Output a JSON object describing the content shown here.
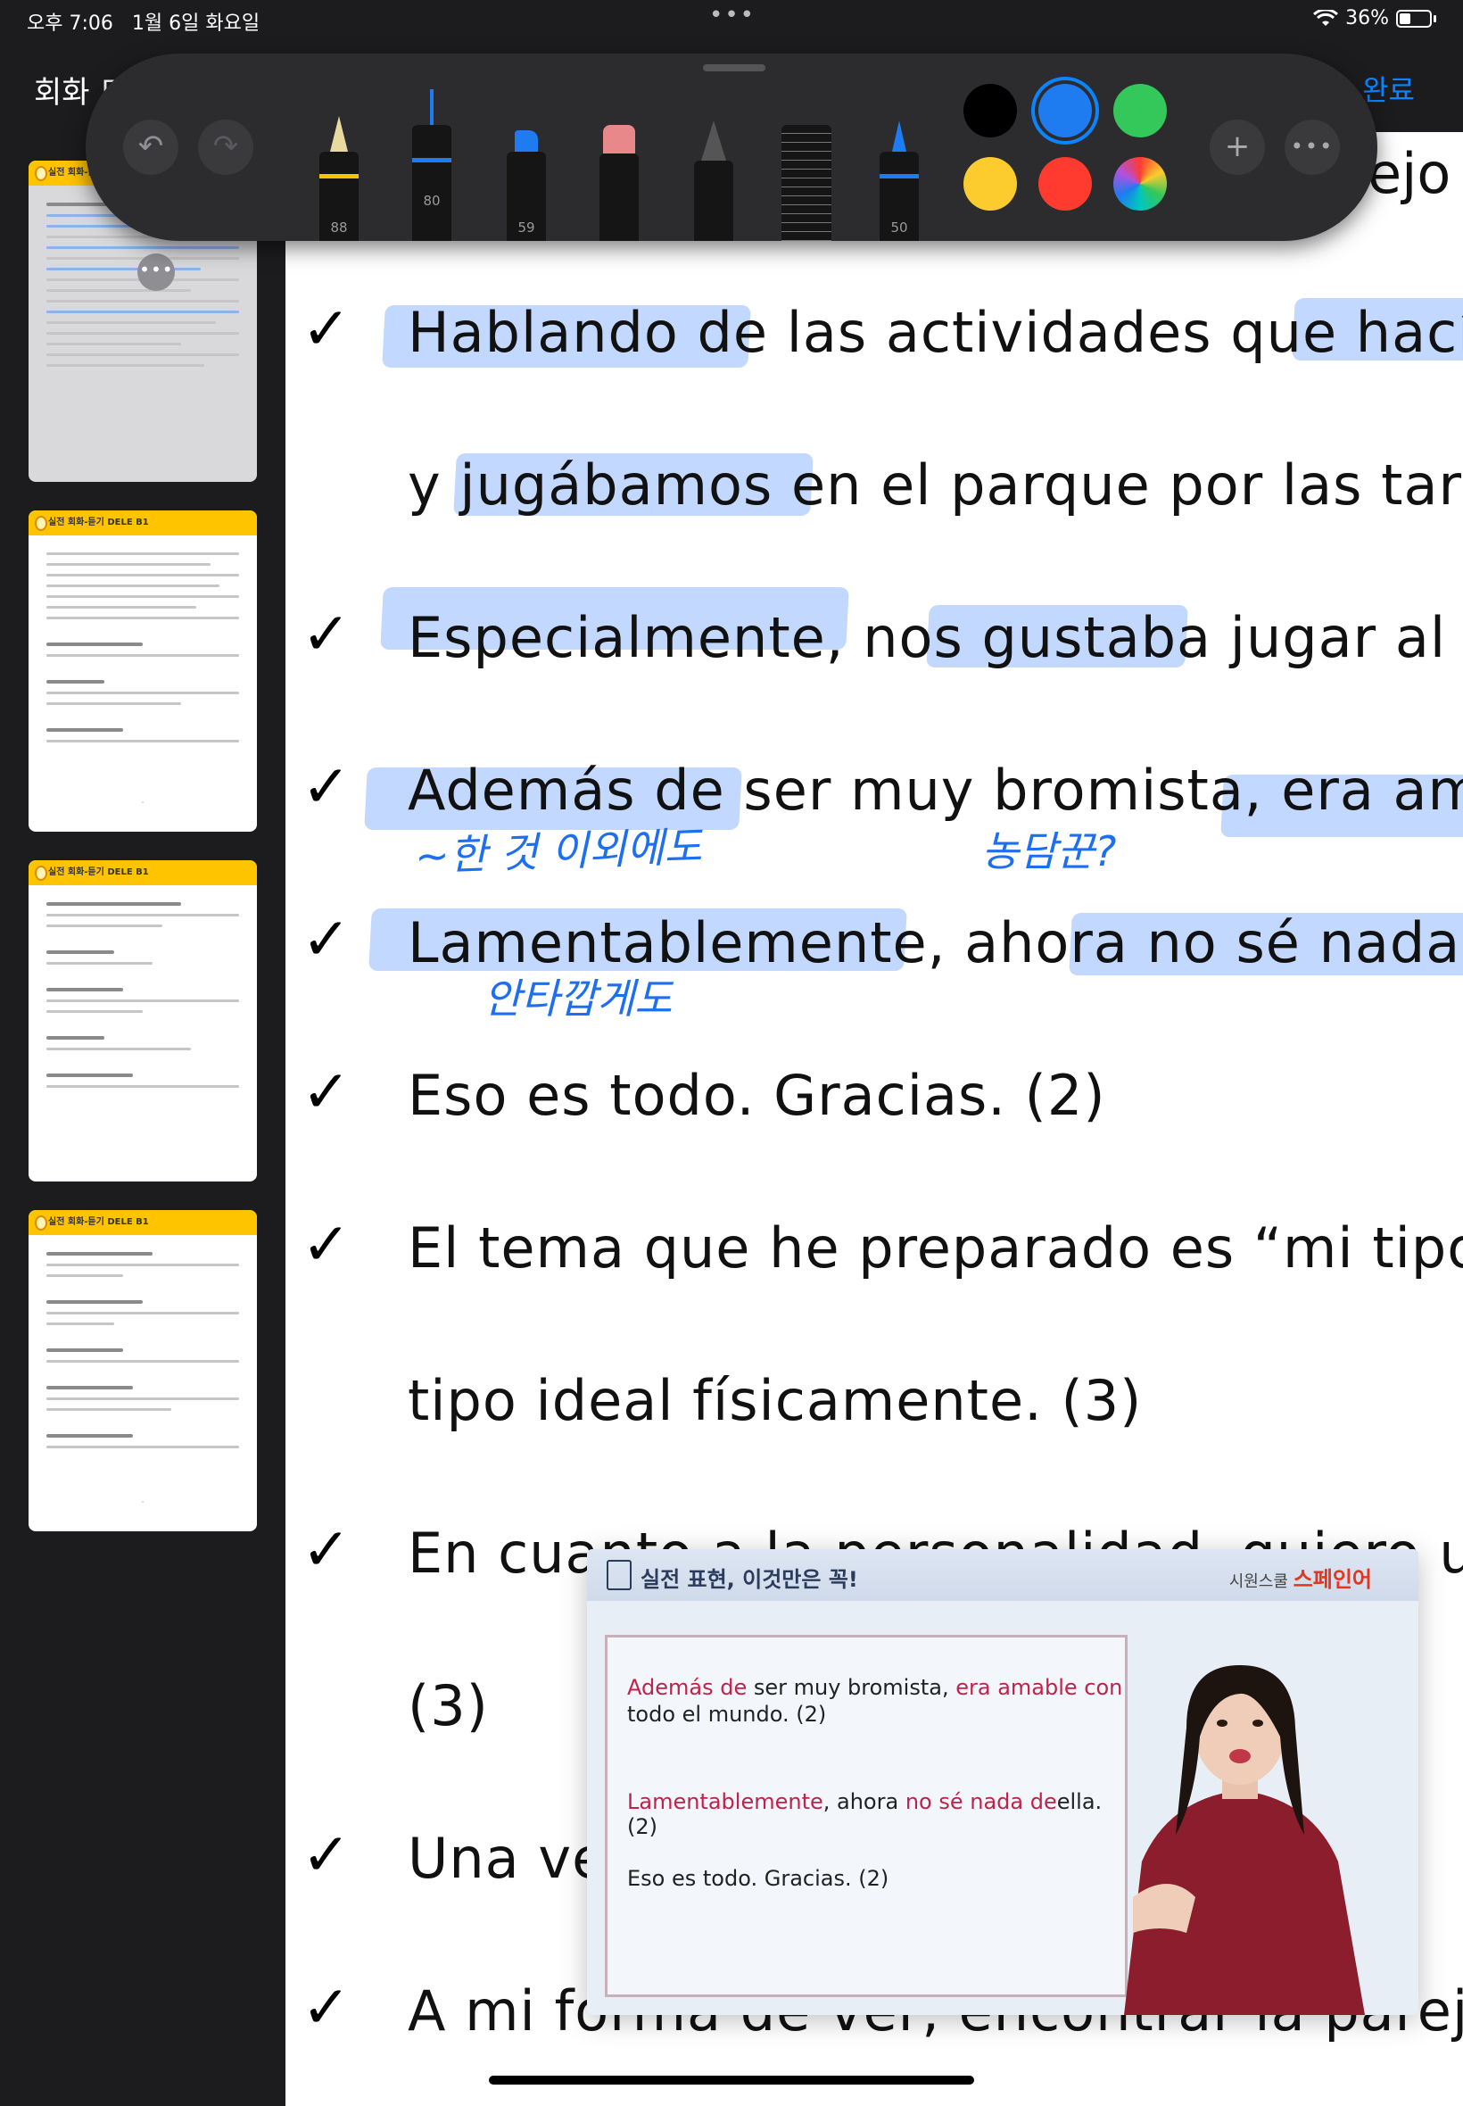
{
  "status_bar": {
    "time": "오후 7:06",
    "date": "1월 6일 화요일",
    "battery_percent": "36%",
    "battery_level": 0.36,
    "wifi_icon": "wifi-icon",
    "multitask_icon": "more-dots-icon"
  },
  "header": {
    "title": "회화 드",
    "done_label": "완료"
  },
  "toolbar": {
    "undo_icon": "undo-icon",
    "redo_icon": "redo-icon",
    "tools": [
      {
        "name": "pen",
        "value": "88",
        "color": "#f5c400"
      },
      {
        "name": "fineliner",
        "value": "80",
        "color": "#1e7bf0"
      },
      {
        "name": "marker",
        "value": "59",
        "color": "#1e7bf0"
      },
      {
        "name": "eraser",
        "value": "",
        "color": "#e8888a"
      },
      {
        "name": "pencil",
        "value": "",
        "color": "#666666"
      },
      {
        "name": "ruler",
        "value": "",
        "color": "#2c2c2e"
      },
      {
        "name": "crayon",
        "value": "50",
        "color": "#1e7bf0"
      }
    ],
    "colors": [
      {
        "name": "black",
        "hex": "#000000",
        "selected": false
      },
      {
        "name": "blue",
        "hex": "#1e7bf0",
        "selected": true
      },
      {
        "name": "green",
        "hex": "#34c759",
        "selected": false
      },
      {
        "name": "yellow",
        "hex": "#fccc2e",
        "selected": false
      },
      {
        "name": "red",
        "hex": "#ff3b30",
        "selected": false
      },
      {
        "name": "multicolor",
        "hex": "conic",
        "selected": false
      }
    ],
    "add_icon": "plus-icon",
    "more_icon": "more-icon"
  },
  "sidebar": {
    "pages": [
      {
        "header": "실전 회화-듣기",
        "selected": true
      },
      {
        "header": "실전 회화-듣기 DELE B1",
        "selected": false
      },
      {
        "header": "실전 회화-듣기 DELE B1",
        "selected": false
      },
      {
        "header": "실전 회화-듣기 DELE B1",
        "selected": false
      }
    ],
    "menu_label": "•••"
  },
  "document": {
    "top_fragment": "ejo",
    "lines": [
      {
        "check": "✓",
        "text": "Hablando de las actividades que hacían"
      },
      {
        "check": "",
        "text": "y jugábamos en el parque por las tarde"
      },
      {
        "check": "✓",
        "text": "Especialmente, nos gustaba jugar al esc"
      },
      {
        "check": "✓",
        "text": "Además de ser muy bromista, era amab"
      },
      {
        "check": "✓",
        "text": "Lamentablemente, ahora no sé nada de"
      },
      {
        "check": "✓",
        "text": "Eso es todo. Gracias. (2)"
      },
      {
        "check": "✓",
        "text": "El tema que he preparado es “mi tipo"
      },
      {
        "check": "",
        "text": "tipo ideal físicamente. (3)"
      },
      {
        "check": "✓",
        "text": "En cuanto a la personalidad, quiero un c"
      },
      {
        "check": "",
        "text": "(3)"
      },
      {
        "check": "✓",
        "text": "Una vez"
      },
      {
        "check": "✓",
        "text": "A mi forma de ver, encontrar la pareja"
      }
    ],
    "annotations": [
      "~한 것 이외에도",
      "농담꾼?",
      "안타깝게도"
    ]
  },
  "video": {
    "header_title": "실전 표현, 이것만은 꼭!",
    "brand_prefix": "시원스쿨",
    "brand": "스페인어",
    "lines": [
      {
        "red": "Además de",
        "rest": " ser muy bromista, ",
        "red2": "era amable con"
      },
      {
        "red": "",
        "rest": "todo el mundo. (2)",
        "red2": ""
      },
      {
        "red": "Lamentablemente",
        "rest": ", ahora ",
        "red2": "no sé nada de",
        "tail": "ella. (2)"
      },
      {
        "red": "",
        "rest": "Eso es todo. Gracias. (2)",
        "red2": ""
      }
    ]
  }
}
